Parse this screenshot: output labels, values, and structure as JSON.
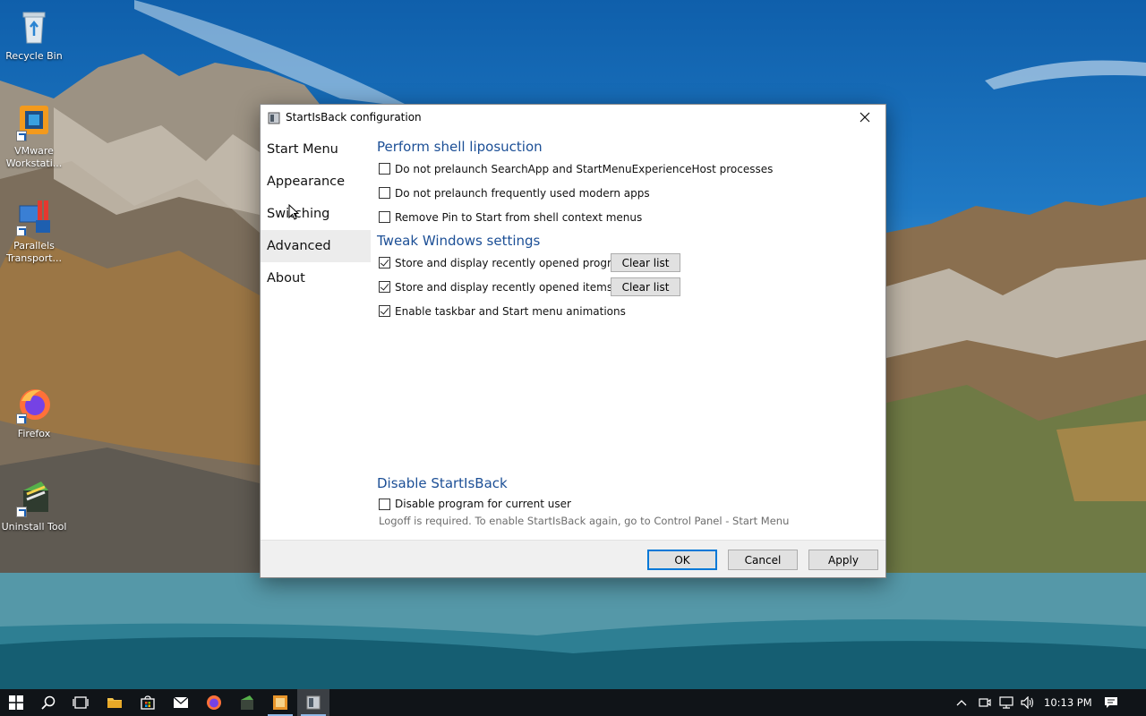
{
  "desktop": {
    "icons": [
      {
        "label": "Recycle Bin",
        "icon": "recycle-bin-icon"
      },
      {
        "label": "VMware Workstati...",
        "icon": "vmware-icon"
      },
      {
        "label": "Parallels Transport...",
        "icon": "parallels-icon"
      },
      {
        "label": "Firefox",
        "icon": "firefox-icon"
      },
      {
        "label": "Uninstall Tool",
        "icon": "uninstall-tool-icon"
      }
    ]
  },
  "dialog": {
    "title": "StartIsBack configuration",
    "nav": [
      "Start Menu",
      "Appearance",
      "Switching",
      "Advanced",
      "About"
    ],
    "selected_nav": "Advanced",
    "section_shell": "Perform shell liposuction",
    "shell_options": [
      {
        "label": "Do not prelaunch SearchApp and StartMenuExperienceHost processes",
        "checked": false
      },
      {
        "label": "Do not prelaunch frequently used modern apps",
        "checked": false
      },
      {
        "label": "Remove Pin to Start from shell context menus",
        "checked": false
      }
    ],
    "section_tweak": "Tweak Windows settings",
    "tweak_options": [
      {
        "label": "Store and display recently opened programs",
        "checked": true,
        "button": "Clear list"
      },
      {
        "label": "Store and display recently opened items",
        "checked": true,
        "button": "Clear list"
      },
      {
        "label": "Enable taskbar and Start menu animations",
        "checked": true
      }
    ],
    "section_disable": "Disable StartIsBack",
    "disable_option": {
      "label": "Disable program for current user",
      "checked": false
    },
    "disable_note": "Logoff is required. To enable StartIsBack again, go to Control Panel - Start Menu",
    "buttons": {
      "ok": "OK",
      "cancel": "Cancel",
      "apply": "Apply"
    }
  },
  "taskbar": {
    "items": [
      "start-icon",
      "search-icon",
      "task-view-icon",
      "file-explorer-icon",
      "store-icon",
      "mail-icon",
      "firefox-icon",
      "uninstall-tool-icon",
      "app-icon",
      "startisback-icon"
    ],
    "clock": "10:13 PM",
    "tray_icons": [
      "chevron-up-icon",
      "meet-now-icon",
      "network-icon",
      "volume-icon",
      "notifications-icon"
    ]
  },
  "colors": {
    "accent": "#0078d7",
    "section_heading": "#1c4f96",
    "taskbar": "#101418"
  }
}
